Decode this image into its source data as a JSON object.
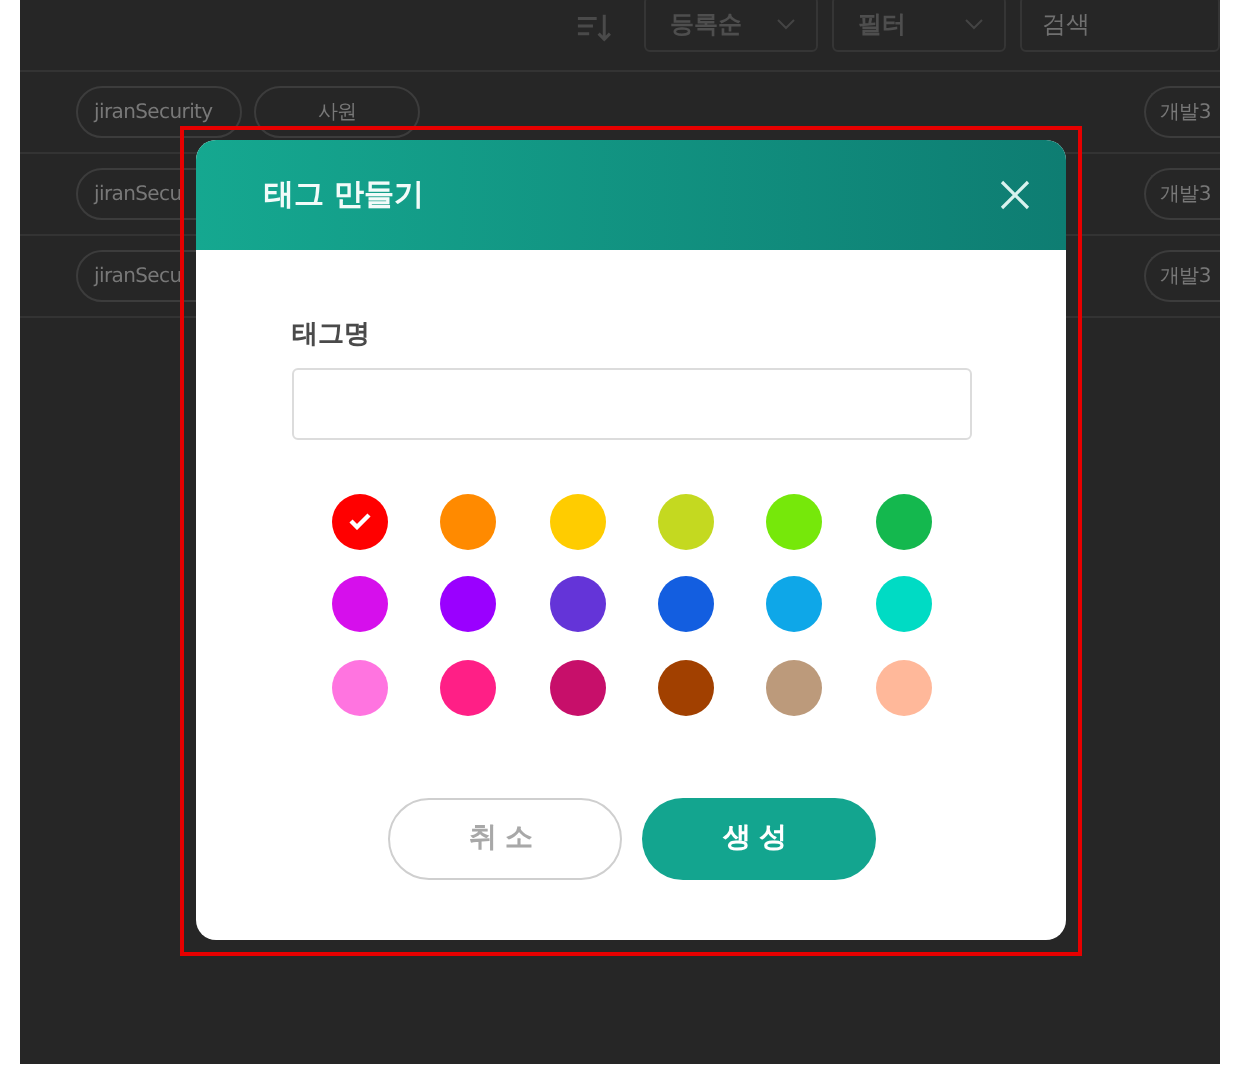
{
  "toolbar": {
    "sort": {
      "label": "등록순"
    },
    "filter": {
      "label": "필터"
    },
    "search": {
      "placeholder": "검색"
    }
  },
  "rows": [
    {
      "tags": [
        "jiranSecurity",
        "사원"
      ],
      "right_tag": "개발3"
    },
    {
      "tags": [
        "jiranSecu"
      ],
      "right_tag": "개발3"
    },
    {
      "tags": [
        "jiranSecu"
      ],
      "right_tag": "개발3"
    }
  ],
  "dialog": {
    "title": "태그 만들기",
    "field_label": "태그명",
    "colors": [
      {
        "color": "#ff0000",
        "selected": true
      },
      {
        "color": "#ff8a00",
        "selected": false
      },
      {
        "color": "#ffcc00",
        "selected": false
      },
      {
        "color": "#c4d920",
        "selected": false
      },
      {
        "color": "#76e80a",
        "selected": false
      },
      {
        "color": "#14b84e",
        "selected": false
      },
      {
        "color": "#d60fec",
        "selected": false
      },
      {
        "color": "#9a00ff",
        "selected": false
      },
      {
        "color": "#6434d8",
        "selected": false
      },
      {
        "color": "#135ee0",
        "selected": false
      },
      {
        "color": "#0ea7e8",
        "selected": false
      },
      {
        "color": "#00dbc4",
        "selected": false
      },
      {
        "color": "#ff74e0",
        "selected": false
      },
      {
        "color": "#ff1f86",
        "selected": false
      },
      {
        "color": "#c70f6a",
        "selected": false
      },
      {
        "color": "#a14000",
        "selected": false
      },
      {
        "color": "#bc9a7b",
        "selected": false
      },
      {
        "color": "#ffb89a",
        "selected": false
      }
    ],
    "buttons": [
      {
        "kind": "cancel",
        "label": "취소"
      },
      {
        "kind": "primary",
        "label": "생성"
      }
    ]
  }
}
